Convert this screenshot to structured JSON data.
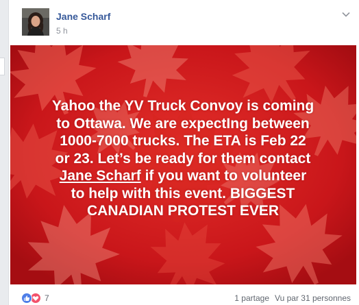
{
  "post": {
    "author": "Jane Scharf",
    "timestamp": "5 h",
    "image_text": {
      "line1": "Yahoo the YV Truck Convoy is coming",
      "line2": "to Ottawa. We are expectIng between",
      "line3": "1000-7000 trucks. The ETA is Feb 22",
      "line4": "or 23. Let’s be ready for them contact",
      "line5_mention": "Jane Scharf",
      "line5_rest": " if you want to volunteer",
      "line6": "to help with this event. BIGGEST",
      "line7": "CANADIAN PROTEST EVER"
    },
    "reactions_count": "7",
    "shares": "1 partage",
    "views": "Vu par 31 personnes"
  },
  "icons": {
    "options": "chevron-down-icon",
    "like": "like-reaction-icon",
    "love": "love-reaction-icon"
  },
  "colors": {
    "author_link": "#365899",
    "background_red": "#d01b1b",
    "like_blue": "#4e7ee8",
    "love_red": "#f2526b"
  }
}
